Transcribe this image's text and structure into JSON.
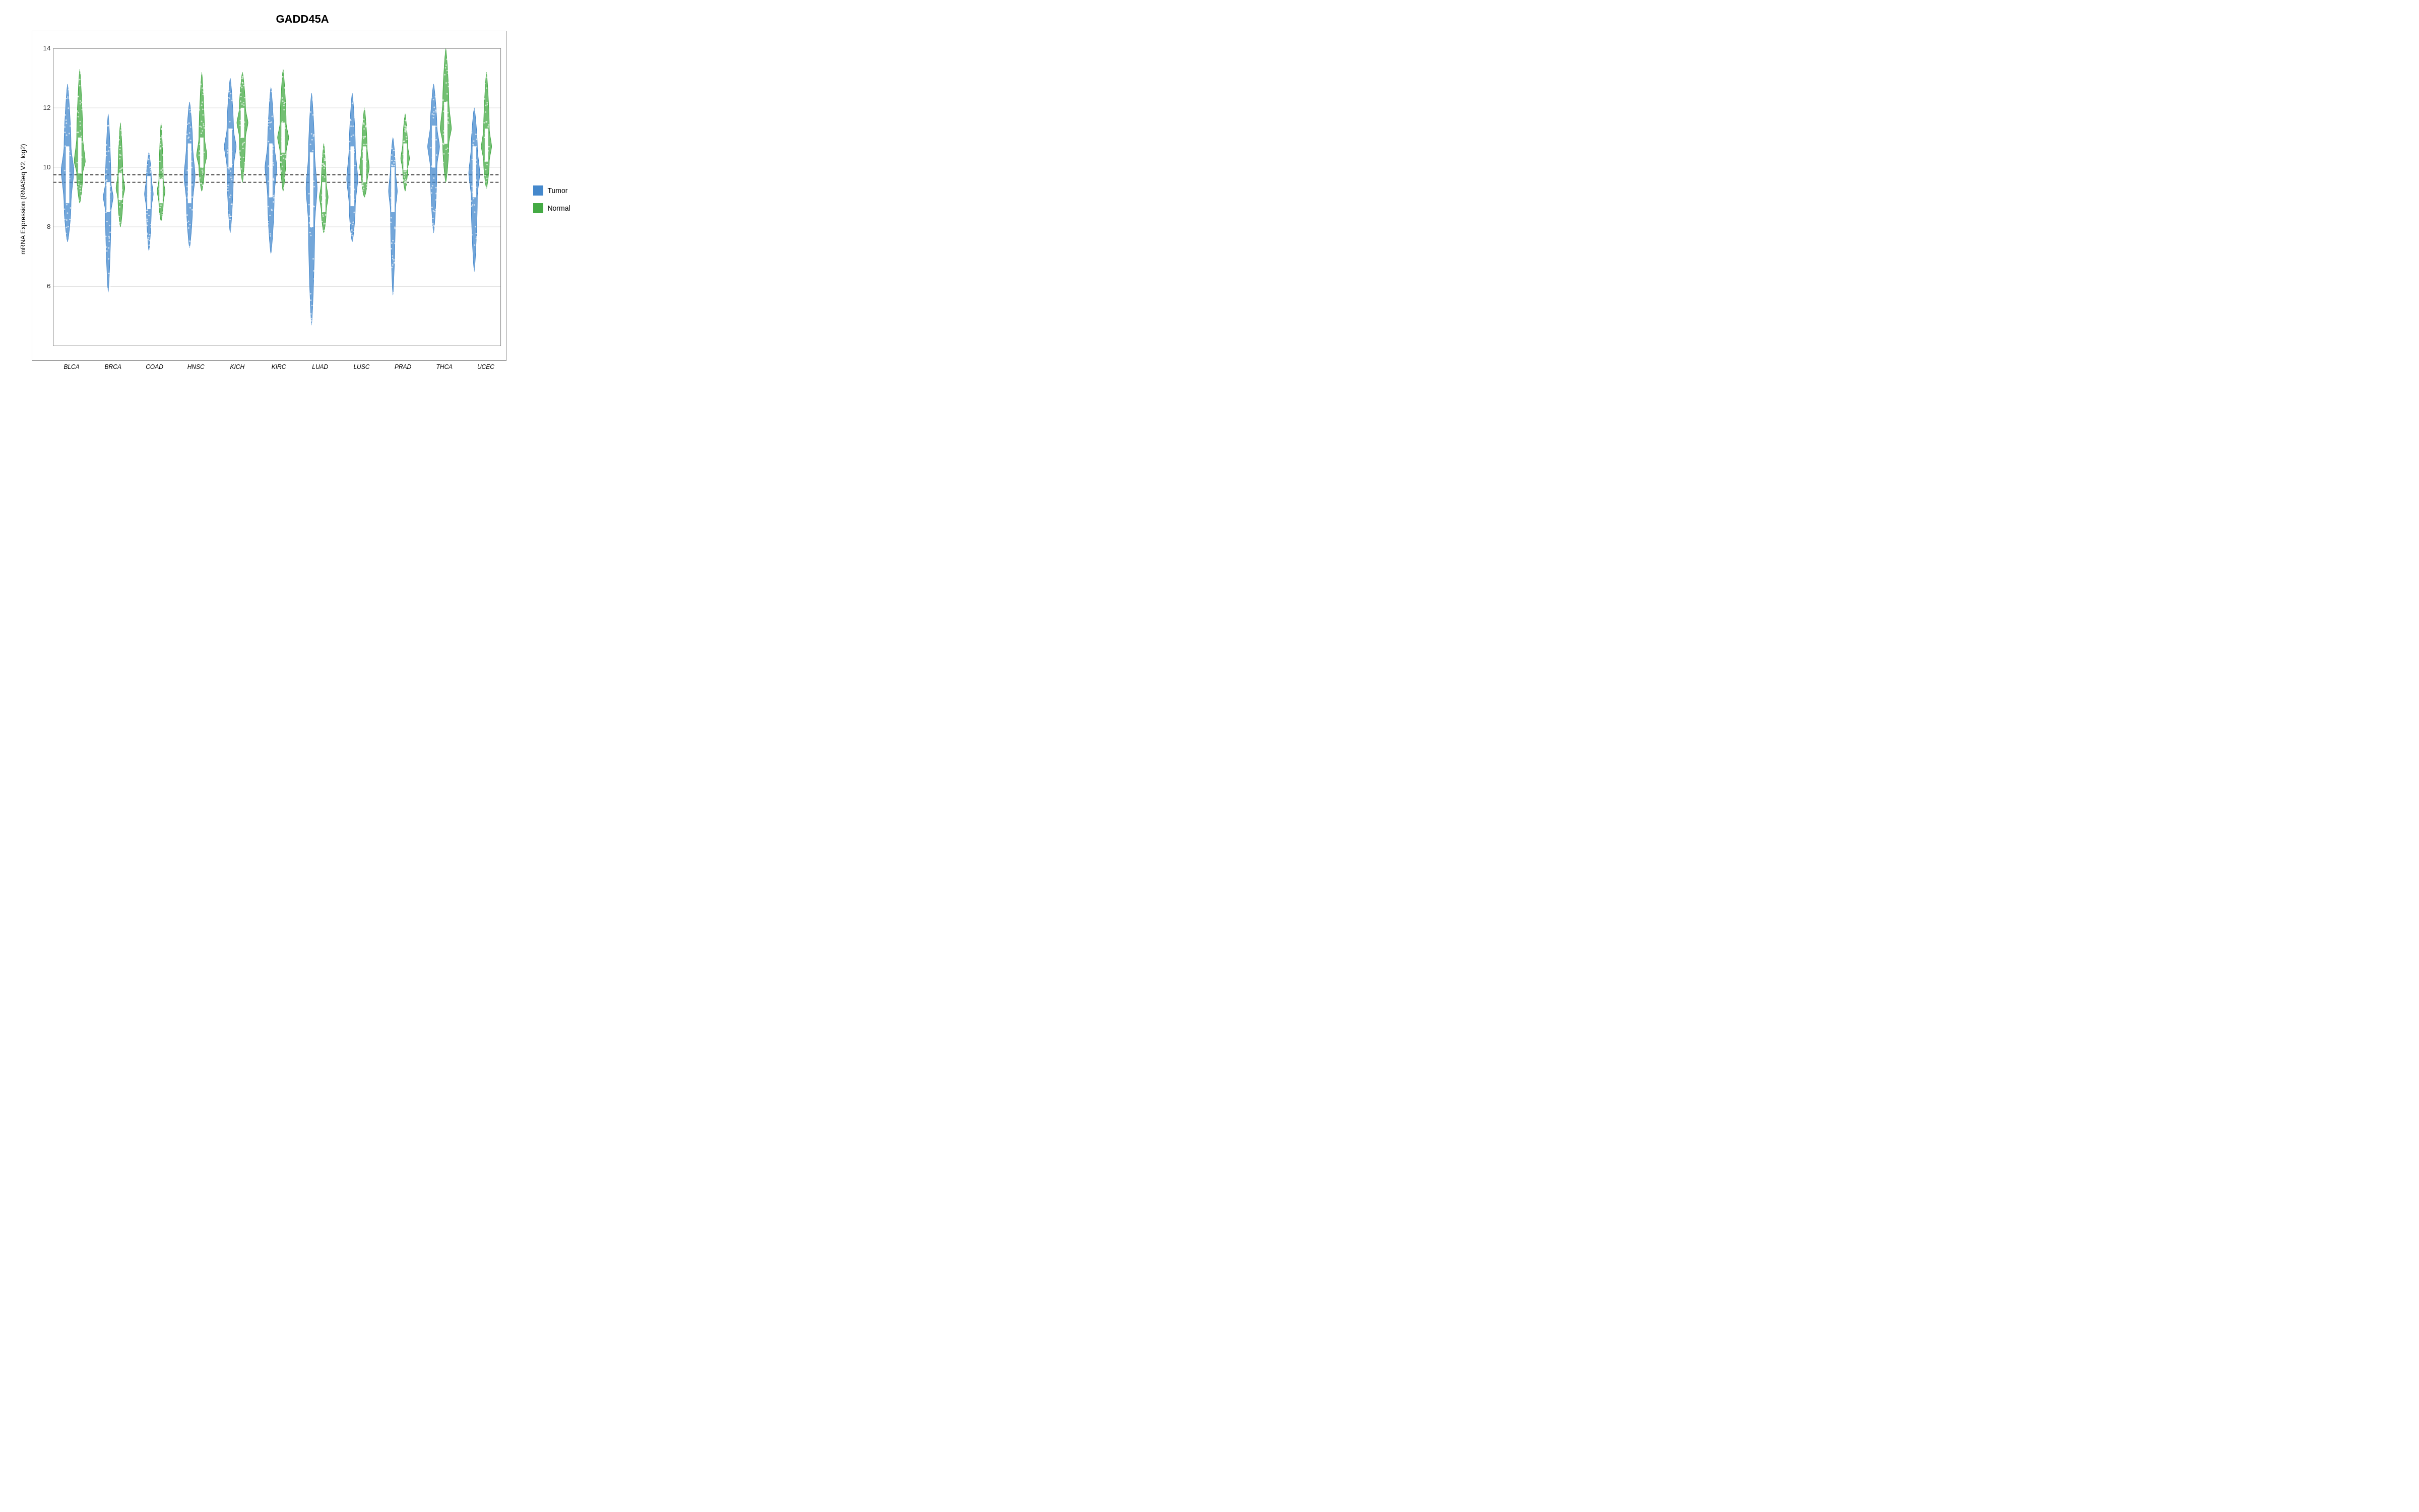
{
  "title": "GADD45A",
  "yAxisLabel": "mRNA Expression (RNASeq V2, log2)",
  "yAxis": {
    "min": 4,
    "max": 14,
    "ticks": [
      6,
      8,
      10,
      12,
      14
    ]
  },
  "xAxis": {
    "labels": [
      "BLCA",
      "BRCA",
      "COAD",
      "HNSC",
      "KICH",
      "KIRC",
      "LUAD",
      "LUSC",
      "PRAD",
      "THCA",
      "UCEC"
    ]
  },
  "legend": {
    "items": [
      {
        "label": "Tumor",
        "color": "#4488cc"
      },
      {
        "label": "Normal",
        "color": "#44aa44"
      }
    ]
  },
  "referenceLine1": 9.5,
  "referenceLine2": 9.75,
  "colors": {
    "tumor": "#4488cc",
    "normal": "#44aa44",
    "axis": "#333333",
    "refLine": "#333333"
  }
}
